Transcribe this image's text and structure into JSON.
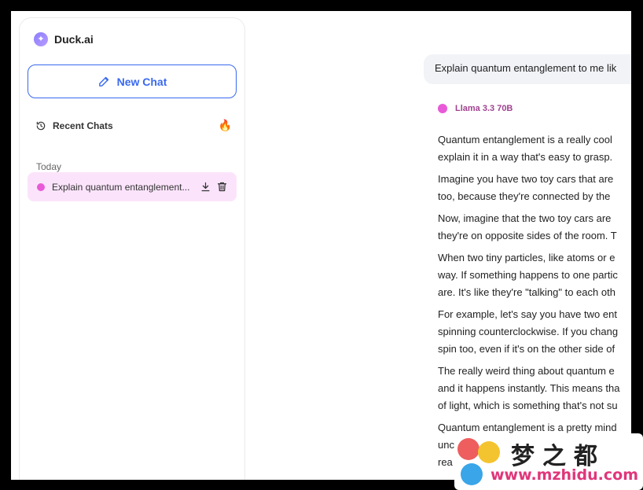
{
  "sidebar": {
    "brand": "Duck.ai",
    "new_chat_label": "New Chat",
    "recent_label": "Recent Chats",
    "group_label": "Today",
    "chats": [
      {
        "title": "Explain quantum entanglement..."
      }
    ]
  },
  "conversation": {
    "user_message": "Explain quantum entanglement to me lik",
    "model_name": "Llama 3.3 70B",
    "response_lines": [
      [
        "Quantum entanglement is a really cool",
        "explain it in a way that's easy to grasp."
      ],
      [
        "Imagine you have two toy cars that are",
        "too, because they're connected by the"
      ],
      [
        "Now, imagine that the two toy cars are",
        "they're on opposite sides of the room. T"
      ],
      [
        "When two tiny particles, like atoms or e",
        "way. If something happens to one partic",
        "are. It's like they're \"talking\" to each oth"
      ],
      [
        "For example, let's say you have two ent",
        "spinning counterclockwise. If you chang",
        "spin too, even if it's on the other side of"
      ],
      [
        "The really weird thing about quantum e",
        "and it happens instantly. This means tha",
        "of light, which is something that's not su"
      ],
      [
        "Quantum entanglement is a pretty mind",
        "unc",
        "rea"
      ]
    ]
  },
  "watermark": {
    "chinese": "梦之都",
    "url": "www.mzhidu.com"
  },
  "colors": {
    "accent": "#3969ef",
    "model_dot": "#e85ad8",
    "selected_chat_bg": "#fbe4fb"
  }
}
